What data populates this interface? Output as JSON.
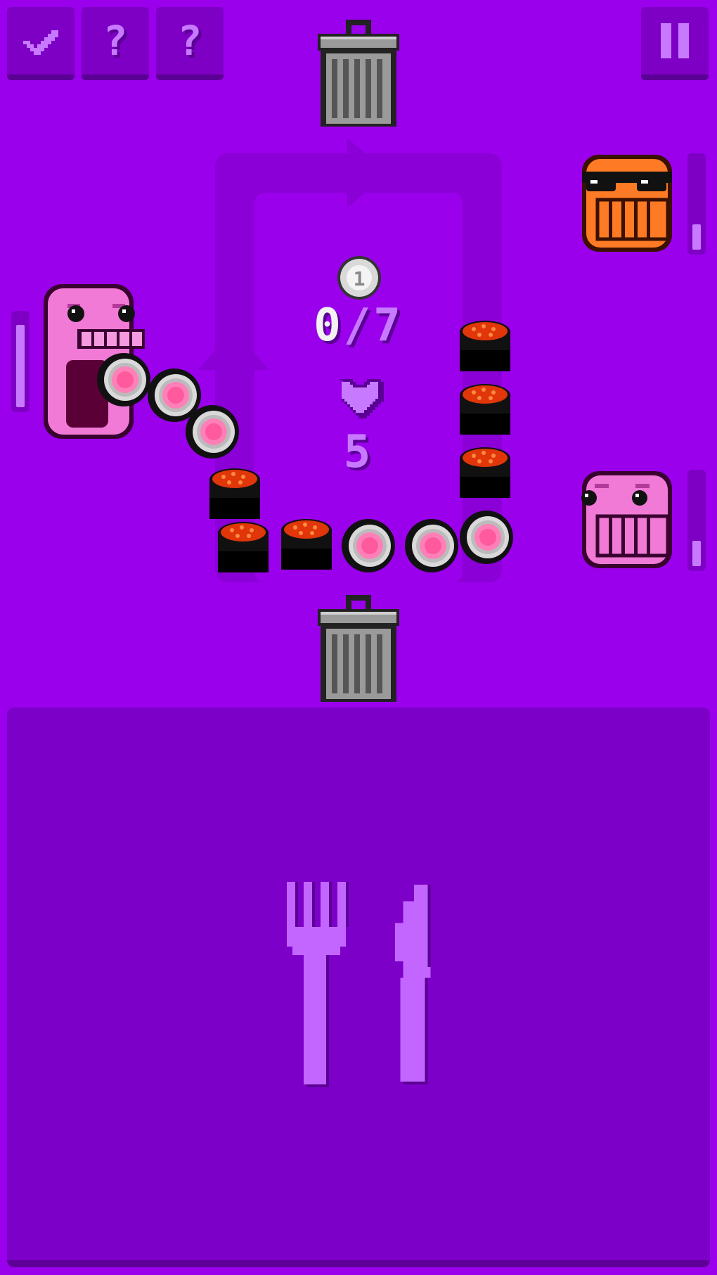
{
  "hud": {
    "buttons": [
      {
        "name": "check-button",
        "icon": "check-icon"
      },
      {
        "name": "hint-button-1",
        "icon": "question-icon",
        "label": "?"
      },
      {
        "name": "hint-button-2",
        "icon": "question-icon",
        "label": "?"
      }
    ],
    "pause_icon": "pause-icon"
  },
  "score": {
    "coin_icon": "coin-icon",
    "coin_label": "1",
    "current": "0",
    "separator": "/",
    "target": "7",
    "lives": "5",
    "heart_icon": "heart-icon"
  },
  "customers": [
    {
      "name": "pink-eater",
      "color": "#f07ad6",
      "meter_fill": 0.85
    },
    {
      "name": "orange-sunglasses",
      "color": "#ff7a24",
      "meter_fill": 0.25
    },
    {
      "name": "pink-waiting",
      "color": "#f07ad6",
      "meter_fill": 0.25
    }
  ],
  "plate": {
    "fork_icon": "fork-icon",
    "knife_icon": "knife-icon"
  },
  "colors": {
    "background": "#9a00ec",
    "track": "#8a00d6",
    "panel": "#7d00c8",
    "accent": "#c77aff"
  }
}
